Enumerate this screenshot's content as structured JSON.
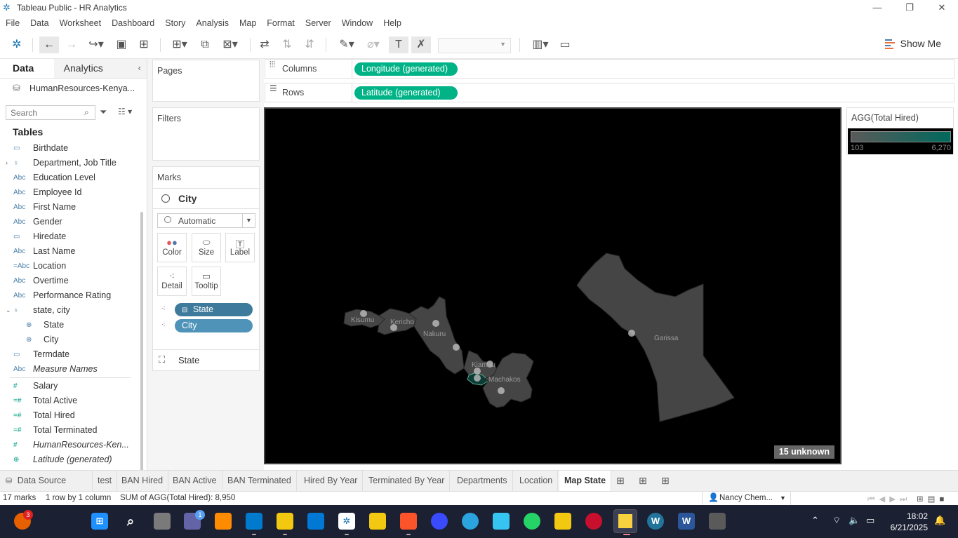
{
  "window": {
    "title": "Tableau Public - HR Analytics",
    "minimize": "—",
    "maximize": "❐",
    "close": "✕"
  },
  "menu": [
    "File",
    "Data",
    "Worksheet",
    "Dashboard",
    "Story",
    "Analysis",
    "Map",
    "Format",
    "Server",
    "Window",
    "Help"
  ],
  "toolbar": {
    "show_me": "Show Me"
  },
  "data_pane": {
    "tabs": [
      "Data",
      "Analytics"
    ],
    "datasource": "HumanResources-Kenya...",
    "search_placeholder": "Search",
    "tables_heading": "Tables",
    "fields": [
      {
        "icon": "calendar-icon",
        "glyph": "▭",
        "name": "Birthdate"
      },
      {
        "icon": "hierarchy-icon",
        "glyph": "♁",
        "name": "Department, Job Title",
        "expander": "›"
      },
      {
        "icon": "string-icon",
        "glyph": "Abc",
        "name": "Education Level"
      },
      {
        "icon": "string-icon",
        "glyph": "Abc",
        "name": "Employee Id"
      },
      {
        "icon": "string-icon",
        "glyph": "Abc",
        "name": "First Name"
      },
      {
        "icon": "string-icon",
        "glyph": "Abc",
        "name": "Gender"
      },
      {
        "icon": "calendar-icon",
        "glyph": "▭",
        "name": "Hiredate"
      },
      {
        "icon": "string-icon",
        "glyph": "Abc",
        "name": "Last Name"
      },
      {
        "icon": "calc-string-icon",
        "glyph": "=Abc",
        "name": "Location"
      },
      {
        "icon": "string-icon",
        "glyph": "Abc",
        "name": "Overtime"
      },
      {
        "icon": "string-icon",
        "glyph": "Abc",
        "name": "Performance Rating"
      },
      {
        "icon": "hierarchy-icon",
        "glyph": "♁",
        "name": "state, city",
        "expander": "⌄"
      },
      {
        "icon": "globe-icon",
        "glyph": "⊕",
        "name": "State",
        "child": true
      },
      {
        "icon": "globe-icon",
        "glyph": "⊕",
        "name": "City",
        "child": true
      },
      {
        "icon": "calendar-icon",
        "glyph": "▭",
        "name": "Termdate"
      },
      {
        "icon": "string-icon",
        "glyph": "Abc",
        "name": "Measure Names",
        "italic": true
      }
    ],
    "measures": [
      {
        "icon": "number-icon",
        "glyph": "#",
        "name": "Salary"
      },
      {
        "icon": "calc-number-icon",
        "glyph": "=#",
        "name": "Total Active"
      },
      {
        "icon": "calc-number-icon",
        "glyph": "=#",
        "name": "Total Hired"
      },
      {
        "icon": "calc-number-icon",
        "glyph": "=#",
        "name": "Total Terminated"
      },
      {
        "icon": "number-icon",
        "glyph": "#",
        "name": "HumanResources-Ken...",
        "italic": true
      },
      {
        "icon": "globe-icon",
        "glyph": "⊕",
        "name": "Latitude (generated)",
        "italic": true
      }
    ]
  },
  "cards": {
    "pages": "Pages",
    "filters": "Filters",
    "marks": "Marks",
    "marks_layer": "City",
    "mark_type": "Automatic",
    "mark_buttons": [
      "Color",
      "Size",
      "Label",
      "Detail",
      "Tooltip"
    ],
    "mark_pills": [
      "State",
      "City"
    ],
    "layer_state": "State"
  },
  "shelves": {
    "columns_label": "Columns",
    "columns_pill": "Longitude (generated)",
    "rows_label": "Rows",
    "rows_pill": "Latitude (generated)"
  },
  "map": {
    "labels": [
      "Kisumu",
      "Kericho",
      "Nakuru",
      "Kiambu",
      "Machakos",
      "Garissa"
    ],
    "unknown": "15 unknown"
  },
  "legend": {
    "title": "AGG(Total Hired)",
    "min": "103",
    "max": "6,270"
  },
  "sheet_tabs": [
    "Data Source",
    "test",
    "BAN Hired",
    "BAN Active",
    "BAN Terminated",
    "Hired By Year",
    "Terminated By Year",
    "Departments",
    "Location",
    "Map State"
  ],
  "active_tab": "Map State",
  "status": {
    "marks": "17 marks",
    "dims": "1 row by 1 column",
    "sum": "SUM of AGG(Total Hired): 8,950",
    "user": "Nancy Chem..."
  },
  "taskbar": {
    "badge_firefox": "3",
    "badge_teams": "1",
    "time": "18:02",
    "date": "6/21/2025"
  },
  "colors": {
    "accent_green": "#00b386",
    "pill_blue": "#3d7a9b",
    "map_fill": "#444444",
    "legend_high": "#00695c"
  }
}
